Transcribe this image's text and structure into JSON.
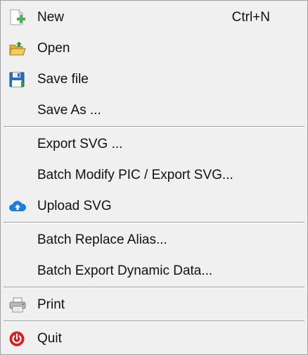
{
  "menu": {
    "items": [
      {
        "label": "New",
        "shortcut": "Ctrl+N",
        "icon": "new-file-icon"
      },
      {
        "label": "Open",
        "icon": "open-folder-icon"
      },
      {
        "label": "Save file",
        "icon": "save-icon"
      },
      {
        "label": "Save As ..."
      },
      {
        "label": "Export SVG ..."
      },
      {
        "label": "Batch Modify PIC / Export SVG..."
      },
      {
        "label": "Upload SVG",
        "icon": "cloud-upload-icon"
      },
      {
        "label": "Batch Replace Alias..."
      },
      {
        "label": "Batch Export Dynamic Data..."
      },
      {
        "label": "Print",
        "icon": "printer-icon"
      },
      {
        "label": "Quit",
        "icon": "power-icon"
      }
    ]
  },
  "colors": {
    "background": "#f0f0f0",
    "separator": "#a0a0a0",
    "text": "#111111",
    "upload_blue": "#1e7fd8",
    "quit_red": "#d42020"
  }
}
